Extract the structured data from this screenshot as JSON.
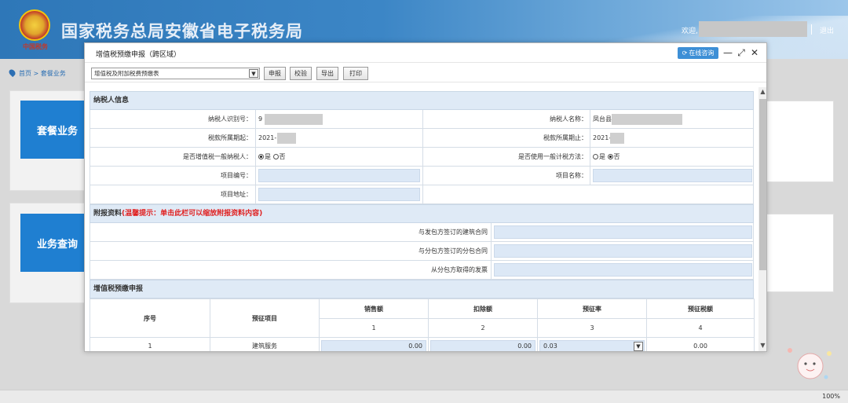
{
  "header": {
    "emblem_caption": "中国税务",
    "site_title": "国家税务总局安徽省电子税务局",
    "welcome": "欢迎,",
    "logout": "退出",
    "username": ""
  },
  "breadcrumb": {
    "home": "首页",
    "separator": ">",
    "current": "套餐业务"
  },
  "background_panels": [
    {
      "label": "套餐业务"
    },
    {
      "label": "业务查询"
    }
  ],
  "modal": {
    "title": "增值税预缴申报（跨区域）",
    "consult_label": "在线咨询",
    "controls": {
      "minimize": "—",
      "maximize": "⤢",
      "close": "✕"
    },
    "toolbar": {
      "selected_form": "增值税及附加税费预缴表",
      "buttons": [
        "申报",
        "校验",
        "导出",
        "打印"
      ]
    },
    "taxpayer_section": {
      "heading": "纳税人信息",
      "taxpayer_id_label": "纳税人识别号：",
      "taxpayer_id_value": "9",
      "taxpayer_name_label": "纳税人名称：",
      "taxpayer_name_value": "凤台县",
      "period_start_label": "税款所属期起：",
      "period_start_value": "2021-",
      "period_end_label": "税款所属期止：",
      "period_end_value": "2021-",
      "general_taxpayer_label": "是否增值税一般纳税人：",
      "general_method_label": "是否使用一般计税方法：",
      "yes": "是",
      "no": "否",
      "general_taxpayer_selected": "是",
      "general_method_selected": "否",
      "project_no_label": "项目编号：",
      "project_name_label": "项目名称：",
      "project_address_label": "项目地址："
    },
    "attachment_section": {
      "heading": "附报资料",
      "hint": "(温馨提示：单击此栏可以缩放附报资料内容)",
      "rows": [
        "与发包方签订的建筑合同",
        "与分包方签订的分包合同",
        "从分包方取得的发票"
      ]
    },
    "vat_section": {
      "heading": "增值税预缴申报",
      "columns": {
        "seq": "序号",
        "item": "预征项目",
        "sales": "销售额",
        "deduction": "扣除额",
        "rate": "预征率",
        "tax": "预征税额"
      },
      "column_numbers": [
        "1",
        "2",
        "3",
        "4"
      ],
      "rows": [
        {
          "seq": "1",
          "item": "建筑服务",
          "sales": "0.00",
          "deduction": "0.00",
          "rate": "0.03",
          "tax": "0.00"
        }
      ]
    }
  },
  "statusbar": {
    "zoom": "100%"
  }
}
